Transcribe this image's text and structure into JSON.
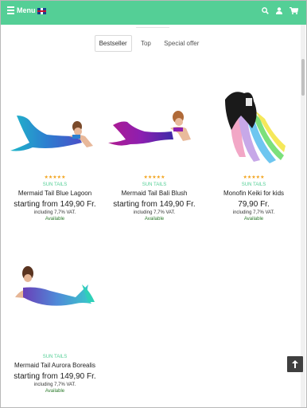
{
  "header": {
    "menu_label": "Menu",
    "icons": [
      "menu-icon",
      "uk-flag-icon",
      "search-icon",
      "user-icon",
      "cart-icon"
    ],
    "brand_color": "#54cf96"
  },
  "tabs": [
    {
      "label": "Bestseller",
      "active": true
    },
    {
      "label": "Top",
      "active": false
    },
    {
      "label": "Special offer",
      "active": false
    }
  ],
  "products": [
    {
      "brand": "SUN TAILS",
      "name": "Mermaid Tail Blue Lagoon",
      "price": "starting from 149,90 Fr.",
      "vat": "including 7,7% VAT.",
      "availability": "Available",
      "rating": 5
    },
    {
      "brand": "SUN TAILS",
      "name": "Mermaid Tail Bali Blush",
      "price": "starting from 149,90 Fr.",
      "vat": "including 7,7% VAT.",
      "availability": "Available",
      "rating": 5
    },
    {
      "brand": "SUN TAILS",
      "name": "Monofin Keiki for kids",
      "price": "79,90 Fr.",
      "vat": "including 7,7% VAT.",
      "availability": "Available",
      "rating": 5
    },
    {
      "brand": "SUN TAILS",
      "name": "Mermaid Tail Aurora Borealis",
      "price": "starting from 149,90 Fr.",
      "vat": "including 7,7% VAT.",
      "availability": "Available",
      "rating": 0
    }
  ],
  "colors": {
    "stars": "#f2a31b",
    "available": "#2a7a2a",
    "back_to_top": "#3f3f3f"
  }
}
